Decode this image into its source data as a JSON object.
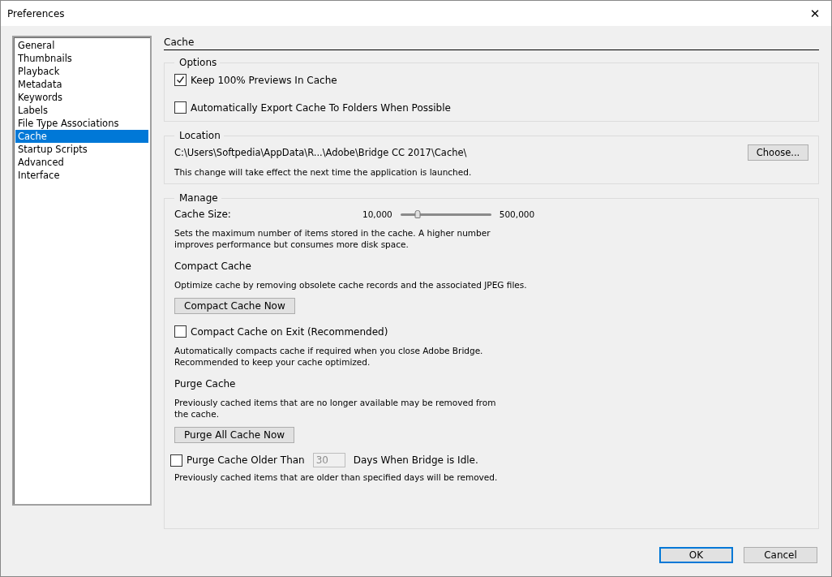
{
  "window": {
    "title": "Preferences",
    "close": "✕"
  },
  "sidebar": {
    "items": [
      {
        "label": "General",
        "selected": false
      },
      {
        "label": "Thumbnails",
        "selected": false
      },
      {
        "label": "Playback",
        "selected": false
      },
      {
        "label": "Metadata",
        "selected": false
      },
      {
        "label": "Keywords",
        "selected": false
      },
      {
        "label": "Labels",
        "selected": false
      },
      {
        "label": "File Type Associations",
        "selected": false
      },
      {
        "label": "Cache",
        "selected": true
      },
      {
        "label": "Startup Scripts",
        "selected": false
      },
      {
        "label": "Advanced",
        "selected": false
      },
      {
        "label": "Interface",
        "selected": false
      }
    ]
  },
  "page": {
    "title": "Cache"
  },
  "options": {
    "title": "Options",
    "checkboxes": [
      {
        "label": "Keep 100% Previews In Cache",
        "checked": true
      },
      {
        "label": "Automatically Export Cache To Folders When Possible",
        "checked": false
      }
    ]
  },
  "location": {
    "title": "Location",
    "path": "C:\\Users\\Softpedia\\AppData\\R...\\Adobe\\Bridge CC 2017\\Cache\\",
    "button": "Choose...",
    "note": "This change will take effect the next time the application is launched."
  },
  "manage": {
    "title": "Manage",
    "cache_size": {
      "label": "Cache Size:",
      "min": "10,000",
      "max": "500,000",
      "level": 0.19
    },
    "cache_size_note": "Sets the maximum number of items stored in the cache. A higher number improves performance but consumes more disk space.",
    "compact": {
      "title": "Compact Cache",
      "description": "Optimize cache by removing obsolete cache records and the associated JPEG files.",
      "button": "Compact Cache Now",
      "on_exit": {
        "label": "Compact Cache on Exit (Recommended)",
        "checked": false
      },
      "note": "Automatically compacts cache if required when you close Adobe Bridge. Recommended to keep your cache optimized."
    },
    "purge": {
      "title": "Purge Cache",
      "description": "Previously cached items that are no longer available may be removed from the cache.",
      "button": "Purge All Cache Now",
      "older": {
        "label_before": "Purge Cache Older Than",
        "checked": false,
        "days_value": "30",
        "disabled": true,
        "label_after": "Days When Bridge is Idle."
      },
      "note": "Previously cached items that are older than specified days will be removed."
    }
  },
  "buttons": [
    {
      "label": "OK",
      "default": true
    },
    {
      "label": "Cancel",
      "default": false
    }
  ]
}
